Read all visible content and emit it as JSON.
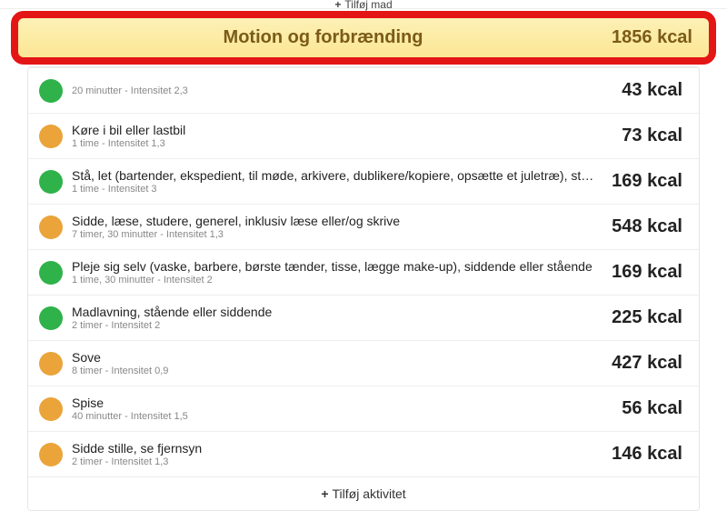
{
  "topbar": {
    "label": "Tilføj mad"
  },
  "header": {
    "title": "Motion og forbrænding",
    "total": "1856 kcal"
  },
  "rows": [
    {
      "color": "green",
      "label": "",
      "sub": "20 minutter - Intensitet 2,3",
      "kcal": "43 kcal"
    },
    {
      "color": "orange",
      "label": "Køre i bil eller lastbil",
      "sub": "1 time - Intensitet 1,3",
      "kcal": "73 kcal"
    },
    {
      "color": "green",
      "label": "Stå, let (bartender, ekspedient, til møde, arkivere, dublikere/kopiere, opsætte et juletræ), stå og sn...",
      "sub": "1 time - Intensitet 3",
      "kcal": "169 kcal"
    },
    {
      "color": "orange",
      "label": "Sidde, læse, studere, generel, inklusiv læse eller/og skrive",
      "sub": "7 timer, 30 minutter - Intensitet 1,3",
      "kcal": "548 kcal"
    },
    {
      "color": "green",
      "label": "Pleje sig selv (vaske, barbere, børste tænder, tisse, lægge make-up), siddende eller stående",
      "sub": "1 time, 30 minutter - Intensitet 2",
      "kcal": "169 kcal"
    },
    {
      "color": "green",
      "label": "Madlavning, stående eller siddende",
      "sub": "2 timer - Intensitet 2",
      "kcal": "225 kcal"
    },
    {
      "color": "orange",
      "label": "Sove",
      "sub": "8 timer - Intensitet 0,9",
      "kcal": "427 kcal"
    },
    {
      "color": "orange",
      "label": "Spise",
      "sub": "40 minutter - Intensitet 1,5",
      "kcal": "56 kcal"
    },
    {
      "color": "orange",
      "label": "Sidde stille, se fjernsyn",
      "sub": "2 timer - Intensitet 1,3",
      "kcal": "146 kcal"
    }
  ],
  "addActivity": {
    "label": "Tilføj aktivitet",
    "plus": "+"
  }
}
